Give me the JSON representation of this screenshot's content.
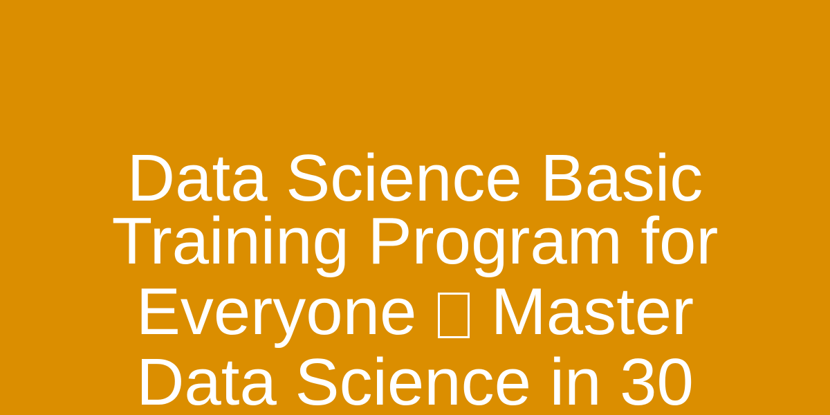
{
  "page": {
    "background_color": "#DB8E00",
    "text_color": "#FFFFFF"
  },
  "title": {
    "line1": "Data Science Basic",
    "line2": "Training Program for",
    "line3_before": "Everyone",
    "line3_after": "Master",
    "line4": "Data Science in 30"
  }
}
